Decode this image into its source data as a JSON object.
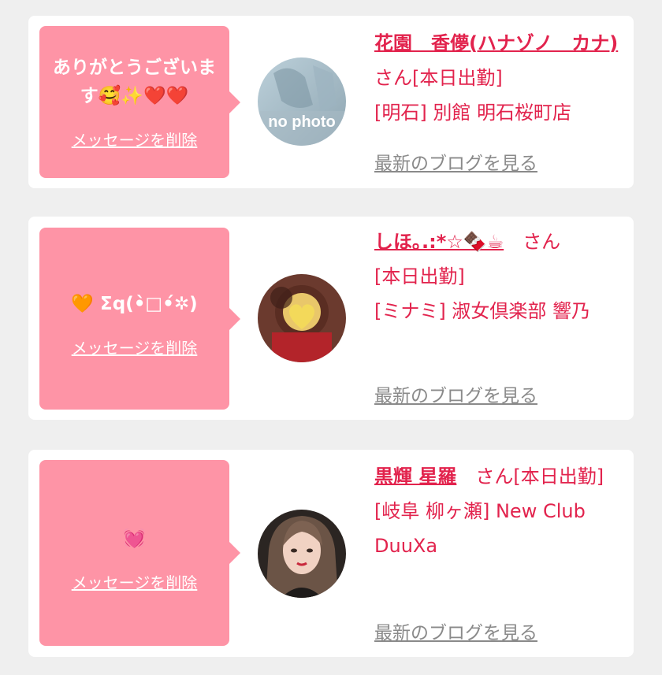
{
  "messages": [
    {
      "bubble_text": "ありがとうございます🥰✨❤️❤️",
      "delete_label": "メッセージを削除",
      "avatar_label": "no photo",
      "name": "花園　香儚(ハナゾノ　カナ)",
      "san": "さん",
      "status": "[本日出勤]",
      "shop": "[明石] 別館 明石桜町店",
      "blog_label": "最新のブログを見る"
    },
    {
      "bubble_text": "🧡 Σq(•̀□•́✲)",
      "delete_label": "メッセージを削除",
      "name": "しほ｡.:*☆🍫☕",
      "san": "さん",
      "status": "[本日出勤]",
      "shop": "[ミナミ] 淑女倶楽部 響乃",
      "blog_label": "最新のブログを見る"
    },
    {
      "bubble_text": "💓",
      "delete_label": "メッセージを削除",
      "name": "黒輝 星羅",
      "san": "さん",
      "status": "[本日出勤]",
      "shop": "[岐阜 柳ヶ瀬] New Club DuuXa",
      "blog_label": "最新のブログを見る"
    }
  ],
  "colors": {
    "page_bg": "#efefef",
    "card_bg": "#ffffff",
    "bubble_bg": "#fe94a6",
    "accent_text": "#e2234d",
    "link_gray": "#8a8a8a"
  }
}
